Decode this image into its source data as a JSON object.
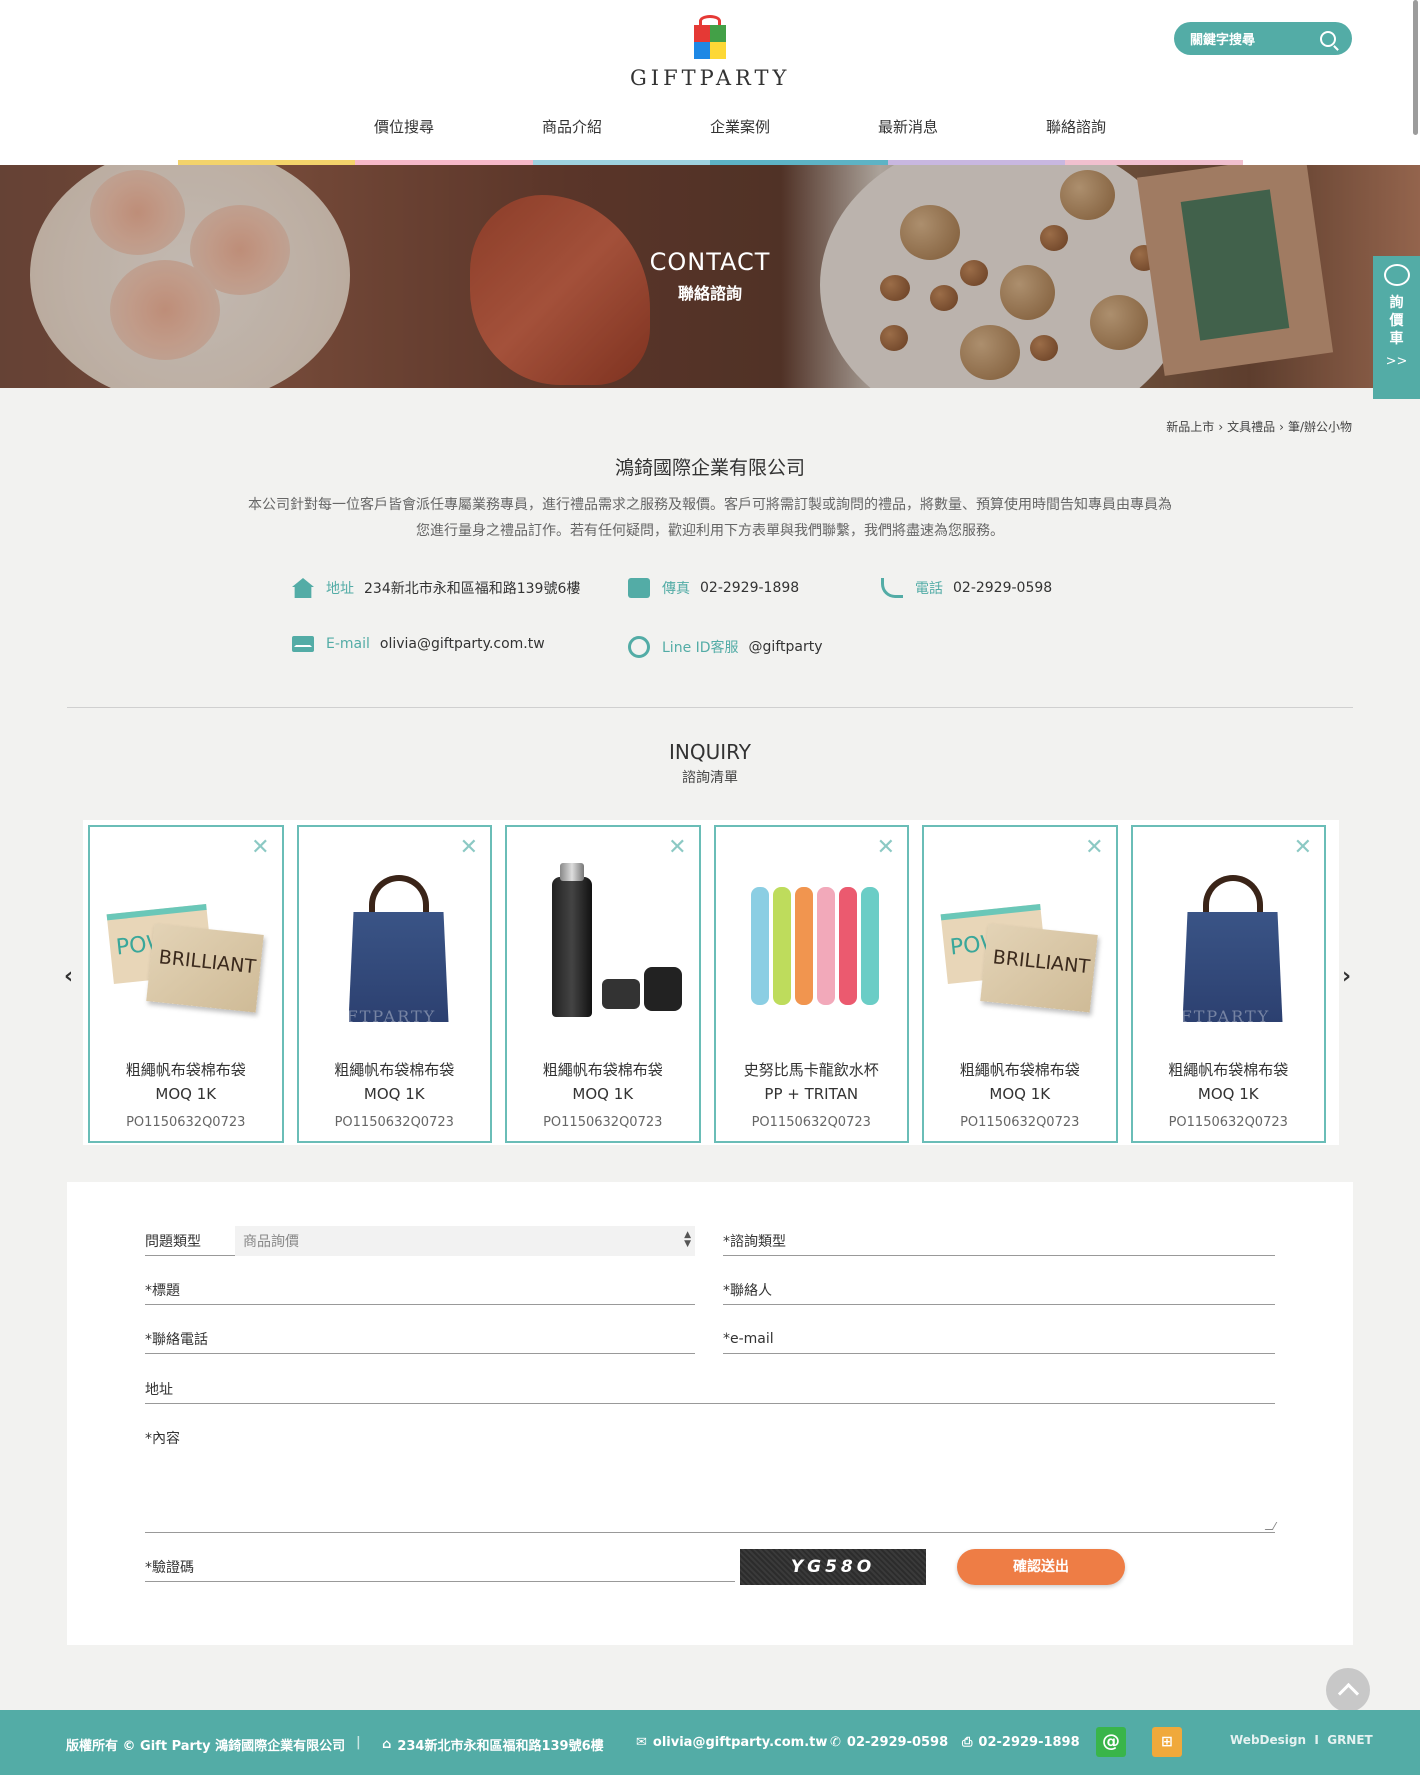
{
  "header": {
    "logo_text": "GIFTPARTY",
    "search_placeholder": "關鍵字搜尋",
    "nav": [
      "價位搜尋",
      "商品介紹",
      "企業案例",
      "最新消息",
      "聯絡諮詢"
    ],
    "nav_colors": [
      "#ffffff",
      "#f3d36b",
      "#f6b8c8",
      "#9ed2df",
      "#5db3c5",
      "#c8b7e0",
      "#f1c0cf",
      "#ffffff"
    ]
  },
  "banner": {
    "title_en": "CONTACT",
    "title_zh": "聯絡諮詢"
  },
  "side_cart": {
    "label": [
      "詢",
      "價",
      "車"
    ],
    "arrow": ">>"
  },
  "breadcrumb": [
    "新品上市",
    "文具禮品",
    "筆/辦公小物"
  ],
  "company": {
    "name": "鴻錡國際企業有限公司",
    "intro_line1": "本公司針對每一位客戶皆會派任專屬業務專員，進行禮品需求之服務及報價。客戶可將需訂製或詢問的禮品，將數量、預算使用時間告知專員由專員為",
    "intro_line2": "您進行量身之禮品訂作。若有任何疑問，歡迎利用下方表單與我們聯繫，我們將盡速為您服務。"
  },
  "contact": {
    "address": {
      "icon": "home-icon",
      "label": "地址",
      "value": "234新北市永和區福和路139號6樓"
    },
    "fax": {
      "icon": "fax-icon",
      "label": "傳真",
      "value": "02-2929-1898"
    },
    "phone": {
      "icon": "phone-icon",
      "label": "電話",
      "value": "02-2929-0598"
    },
    "email": {
      "icon": "mail-icon",
      "label": "E-mail",
      "value": "olivia@giftparty.com.tw"
    },
    "line": {
      "icon": "line-icon",
      "label": "Line ID客服",
      "value": "@giftparty"
    }
  },
  "inquiry": {
    "title_en": "INQUIRY",
    "title_zh": "諮詢清單",
    "items": [
      {
        "name": "粗繩帆布袋棉布袋",
        "moq": "MOQ 1K",
        "code": "PO1150632Q0723",
        "image": "pouch"
      },
      {
        "name": "粗繩帆布袋棉布袋",
        "moq": "MOQ 1K",
        "code": "PO1150632Q0723",
        "image": "tote"
      },
      {
        "name": "粗繩帆布袋棉布袋",
        "moq": "MOQ 1K",
        "code": "PO1150632Q0723",
        "image": "bottle"
      },
      {
        "name": "史努比馬卡龍飲水杯",
        "moq": "PP + TRITAN",
        "code": "PO1150632Q0723",
        "image": "cutlery"
      },
      {
        "name": "粗繩帆布袋棉布袋",
        "moq": "MOQ 1K",
        "code": "PO1150632Q0723",
        "image": "pouch"
      },
      {
        "name": "粗繩帆布袋棉布袋",
        "moq": "MOQ 1K",
        "code": "PO1150632Q0723",
        "image": "tote"
      }
    ],
    "pouch_text_back": "POW",
    "pouch_text_front": "BRILLIANT",
    "watermark": "GIFTPARTY"
  },
  "form": {
    "question_type_label": "問題類型",
    "question_type_value": "商品詢價",
    "inquiry_type_label": "*諮詢類型",
    "title_label": "*標題",
    "contact_label": "*聯絡人",
    "phone_label": "*聯絡電話",
    "email_label": "*e-mail",
    "address_label": "地址",
    "content_label": "*內容",
    "captcha_label": "*驗證碼",
    "captcha_value": "YG58O",
    "submit_label": "確認送出"
  },
  "footer": {
    "copyright": "版權所有 © Gift Party 鴻錡國際企業有限公司",
    "separator": "|",
    "address": "234新北市永和區福和路139號6樓",
    "email": "olivia@giftparty.com.tw",
    "phone": "02-2929-0598",
    "fax": "02-2929-1898",
    "credit": "WebDesign",
    "credit_sep": "I",
    "credit_company": "GRNET"
  }
}
